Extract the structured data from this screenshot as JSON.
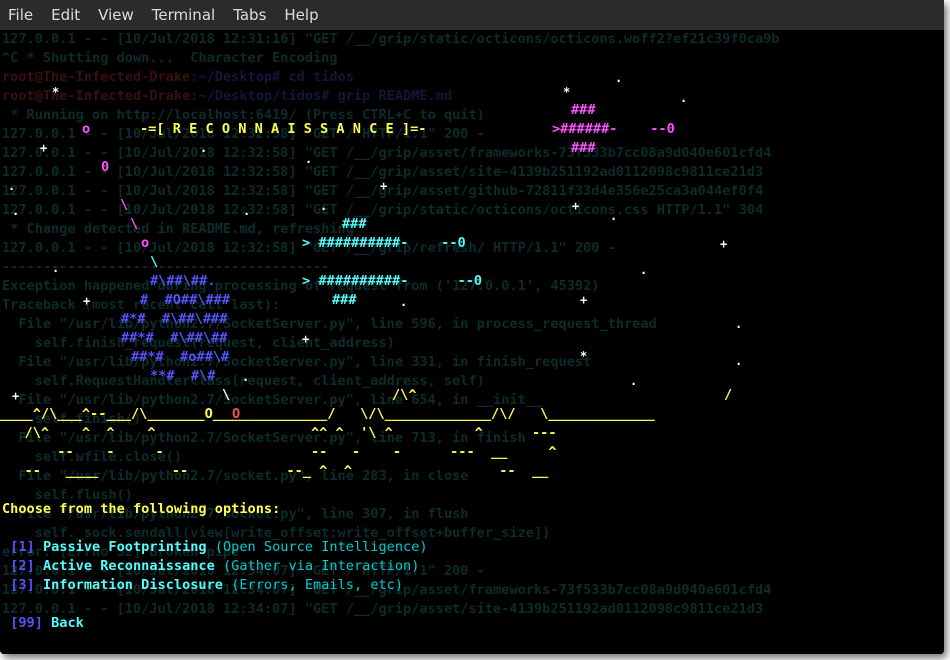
{
  "menu": [
    "File",
    "Edit",
    "View",
    "Terminal",
    "Tabs",
    "Help"
  ],
  "background_log": [
    "127.0.0.1 - - [10/Jul/2018 12:31:16] \"GET /__/grip/static/octicons/octicons.woff2?ef21c39f0ca9b",
    "^C * Shutting down...  Character Encoding",
    "root@The-Infected-Drake:~/Desktop# cd tidos",
    "root@The-Infected-Drake:~/Desktop/tidos# grip README.md",
    " * Running on http://localhost:6419/ (Press CTRL+C to quit)",
    "127.0.0.1 - - [10/Jul/2018 12:32:58] \"GET / HTTP/1.1\" 200 -",
    "127.0.0.1 - - [10/Jul/2018 12:32:58] \"GET /__/grip/asset/frameworks-73f533b7cc08a9d040e601cfd4",
    "127.0.0.1 - - [10/Jul/2018 12:32:58] \"GET /__/grip/asset/site-4139b251192ad0112098c9811ce21d3",
    "127.0.0.1 - - [10/Jul/2018 12:32:58] \"GET /__/grip/asset/github-72811f33d4e356e25ca3a044ef0f4",
    "127.0.0.1 - - [10/Jul/2018 12:32:58] \"GET /__/grip/static/octicons/octicons.css HTTP/1.1\" 304",
    " * Change detected in README.md, refreshing",
    "127.0.0.1 - - [10/Jul/2018 12:32:58] \"GET /__/grip/refresh/ HTTP/1.1\" 200 -",
    "----------------------------------------",
    "Exception happened during processing of request from ('127.0.0.1', 45392)",
    "Traceback (most recent call last):",
    "  File \"/usr/lib/python2.7/SocketServer.py\", line 596, in process_request_thread",
    "    self.finish_request(request, client_address)",
    "  File \"/usr/lib/python2.7/SocketServer.py\", line 331, in finish_request",
    "    self.RequestHandlerClass(request, client_address, self)",
    "  File \"/usr/lib/python2.7/SocketServer.py\", line 654, in __init__",
    "    self.finish()",
    "  File \"/usr/lib/python2.7/SocketServer.py\", line 713, in finish",
    "    self.wfile.close()",
    "  File \"/usr/lib/python2.7/socket.py\", line 283, in close",
    "    self.flush()",
    "  File \"/usr/lib/python2.7/socket.py\", line 307, in flush",
    "    self._sock.sendall(view[write_offset:write_offset+buffer_size])",
    "error: [Errno 32] Broken pipe",
    "127.0.0.1 - - [10/Jul/2018 12:34:07] \"GET / HTTP/1.1\" 200 -",
    "127.0.0.1 - - [10/Jul/2018 12:34:07] \"GET /__/grip/asset/frameworks-73f533b7cc08a9d040e601cfd4",
    "127.0.0.1 - - [10/Jul/2018 12:34:07] \"GET /__/grip/asset/site-4139b251192ad0112098c9811ce21d3"
  ],
  "banner": {
    "title": "-=[ R E C O N N A I S S A N C E ]=-",
    "arrow_top": ">######-    --0",
    "arrow_top_hash1": "###",
    "arrow_top_hash2": "###",
    "arrow_mid1": "> ##########-    --0",
    "arrow_mid2": "> ##########-      --0",
    "arrow_mid_hash1": "###",
    "arrow_mid_hash2": "###",
    "drake": [
      "#\\##\\##.",
      "#  #O##\\###",
      "#*#  #\\##\\###",
      "##*#  #\\##\\##",
      "##*#  #o##\\#",
      "**#  #\\#"
    ],
    "tail_o1": "o",
    "tail_o2": "0",
    "tail_o3": "o",
    "ground1": "____^/\\___^--___/\\_______O______________/   \\/\\_____________/\\/   \\_____________",
    "ground2": "   /\\^    ^  ^    ^                   ^^ ^  '\\ ^          ^      ---",
    "ground3": "       --    -     -                  --   -    -      ---  __     ^",
    "ground4": "   --   ____         --            --_ ^  ^                  --  __",
    "peak1": "/\\^",
    "peak2": "/"
  },
  "prompt": "Choose from the following options:",
  "options": [
    {
      "num": "[1]",
      "label": "Passive Footprinting",
      "desc": "(Open Source Intelligence)"
    },
    {
      "num": "[2]",
      "label": "Active Reconnaissance",
      "desc": "(Gather via Interaction)"
    },
    {
      "num": "[3]",
      "label": "Information Disclosure",
      "desc": "(Errors, Emails, etc)"
    }
  ],
  "back": {
    "num": "[99]",
    "label": "Back"
  },
  "colors": {
    "background": "#000000",
    "menubar": "#2b2b2b",
    "yellow": "#fcfc54",
    "pink": "#fc54fc",
    "cyan": "#54fcfc",
    "blue": "#5454fc",
    "red": "#fc5454"
  }
}
